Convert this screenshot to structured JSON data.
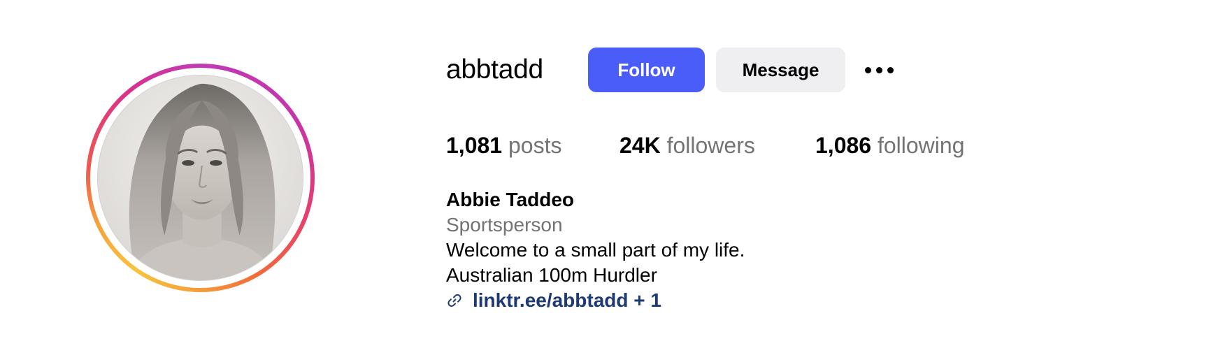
{
  "profile": {
    "username": "abbtadd",
    "follow_label": "Follow",
    "message_label": "Message",
    "more_options_icon": "more-horizontal-icon",
    "avatar_ring_colors": [
      "#f8c33f",
      "#f26b3a",
      "#d8318c",
      "#c13ab6"
    ]
  },
  "stats": {
    "posts_count": "1,081",
    "posts_label": "posts",
    "followers_count": "24K",
    "followers_label": "followers",
    "following_count": "1,086",
    "following_label": "following"
  },
  "bio": {
    "full_name": "Abbie Taddeo",
    "category": "Sportsperson",
    "lines": [
      "Welcome to a small part of my life.",
      "Australian 100m Hurdler"
    ],
    "link_icon": "link-icon",
    "link_text": "linktr.ee/abbtadd + 1"
  },
  "colors": {
    "primary_button": "#4a5df9",
    "secondary_button": "#efeff2",
    "link": "#1e3a75",
    "muted_text": "#737373"
  }
}
